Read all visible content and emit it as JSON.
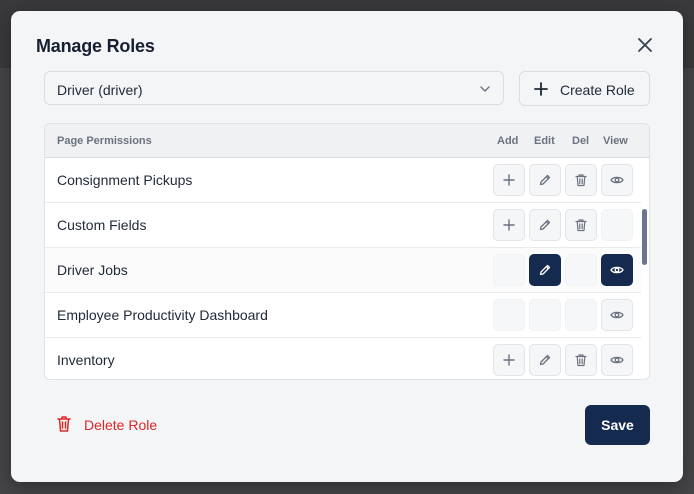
{
  "modal": {
    "title": "Manage Roles",
    "role_select": {
      "value": "Driver (driver)"
    },
    "create_role_label": "Create Role",
    "delete_role_label": "Delete Role",
    "save_label": "Save"
  },
  "table": {
    "columns": {
      "page": "Page Permissions",
      "add": "Add",
      "edit": "Edit",
      "del": "Del",
      "view": "View"
    },
    "rows": [
      {
        "label": "Consignment Pickups",
        "add": "off",
        "edit": "off",
        "del": "off",
        "view": "off"
      },
      {
        "label": "Custom Fields",
        "add": "off",
        "edit": "off",
        "del": "off",
        "view": "empty"
      },
      {
        "label": "Driver Jobs",
        "add": "empty",
        "edit": "on",
        "del": "empty",
        "view": "on"
      },
      {
        "label": "Employee Productivity Dashboard",
        "add": "empty",
        "edit": "empty",
        "del": "empty",
        "view": "off"
      },
      {
        "label": "Inventory",
        "add": "off",
        "edit": "off",
        "del": "off",
        "view": "off"
      }
    ]
  },
  "colors": {
    "accent": "#152a4f",
    "danger": "#dc2626",
    "text": "#1f2937"
  },
  "icons": {
    "close": "close-icon",
    "chevron": "chevron-down-icon",
    "plus": "plus-icon",
    "edit": "pencil-icon",
    "delete": "trash-icon",
    "view": "eye-icon"
  }
}
